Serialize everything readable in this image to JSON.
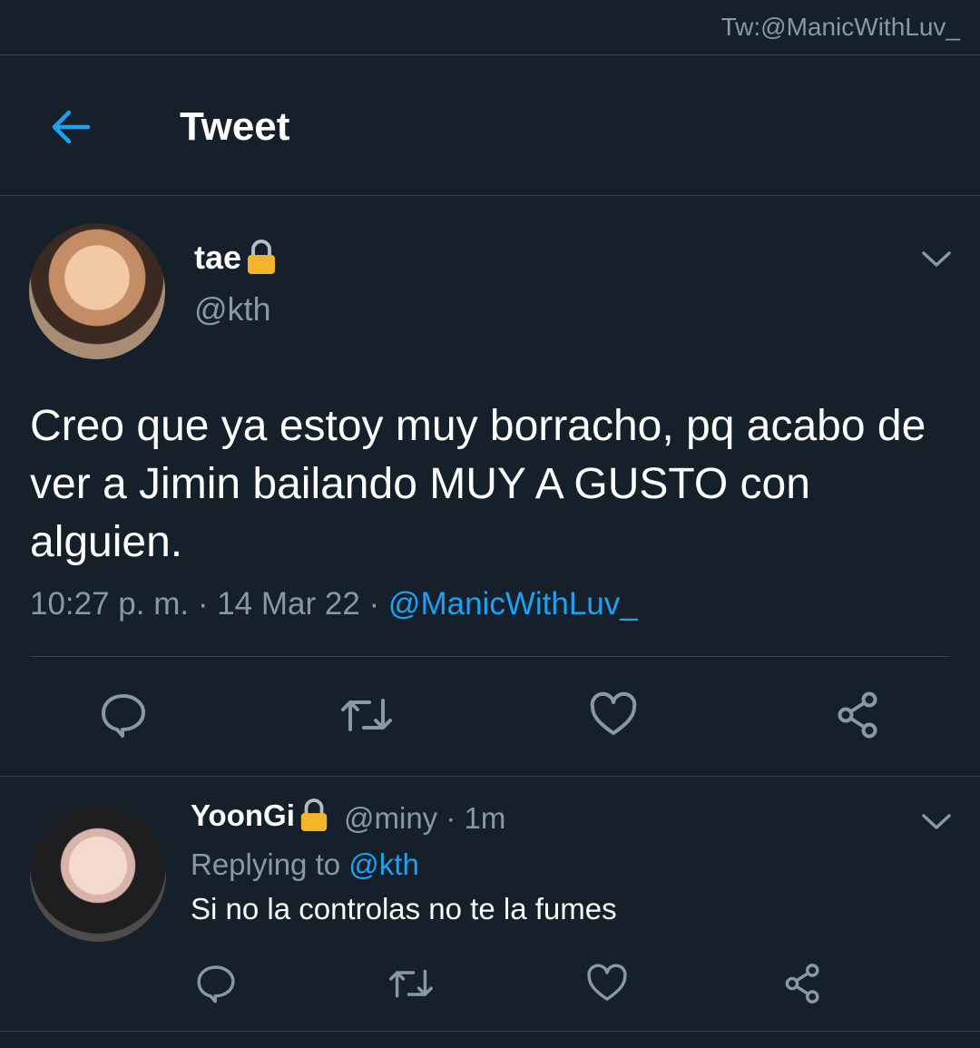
{
  "watermark": "Tw:@ManicWithLuv_",
  "header": {
    "title": "Tweet"
  },
  "tweet": {
    "author_name": "tae",
    "author_handle": "@kth",
    "text": "Creo que ya estoy muy borracho, pq acabo de ver a Jimin bailando MUY A GUSTO con alguien.",
    "time": "10:27 p. m.",
    "date": "14 Mar 22",
    "source": "@ManicWithLuv_",
    "separator": " · "
  },
  "reply": {
    "author_name": "YoonGi",
    "author_handle": "@miny",
    "age": "1m",
    "replying_prefix": "Replying to",
    "replying_handle": "@kth",
    "text": "Si no la controlas no te la fumes"
  },
  "colors": {
    "background": "#15202b",
    "divider": "#38444d",
    "secondary_text": "#8899a6",
    "accent": "#1da1f2",
    "lock": "#f5b52a"
  },
  "icons": [
    "back-arrow-icon",
    "lock-icon",
    "chevron-down-icon",
    "reply-icon",
    "retweet-icon",
    "like-icon",
    "share-icon"
  ]
}
